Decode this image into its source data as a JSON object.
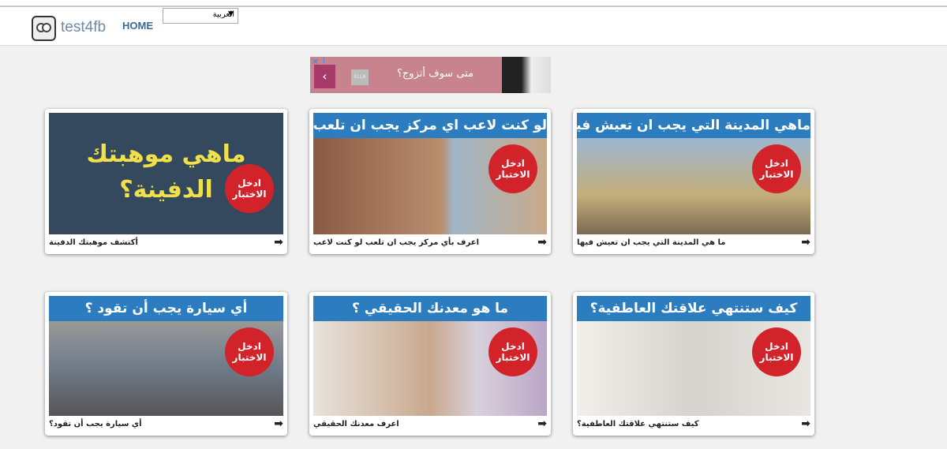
{
  "nav": {
    "brand": "test4fb",
    "home": "HOME",
    "language": "العربية"
  },
  "ad": {
    "text": "متى سوف أتزوج؟",
    "brand": "ELLA",
    "close": "✕",
    "info": "i",
    "back": "‹"
  },
  "badge": "ادخل الاختبار",
  "cards": [
    {
      "banner": "ماهي موهبتك الدفينة؟",
      "caption": "أكتشف موهبتك الدفينة"
    },
    {
      "banner": "لو كنت لاعب اي مركز يجب ان تلعب",
      "caption": "اعرف بأي مركز يجب ان تلعب لو كنت لاعب"
    },
    {
      "banner": "ماهي المدينة التي يجب ان تعيش فيها",
      "caption": "ما هي المدينة التي يجب ان تعيش فيها"
    },
    {
      "banner": "أي سيارة يجب أن تقود ؟",
      "caption": "أي سيارة يجب أن تقود؟"
    },
    {
      "banner": "ما هو معدنك الحقيقي ؟",
      "caption": "اعرف معدنك الحقيقي"
    },
    {
      "banner": "كيف ستنتهي علاقتك العاطفية؟",
      "caption": "كيف ستنتهي علاقتك العاطفية؟"
    }
  ],
  "arrow": "➡"
}
